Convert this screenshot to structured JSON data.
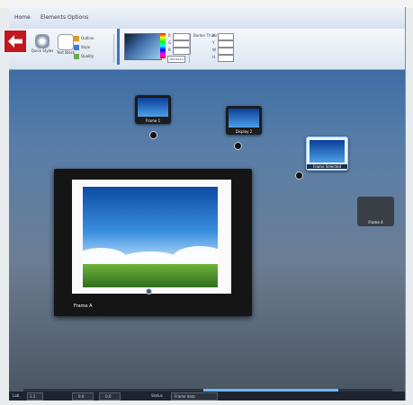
{
  "menu": {
    "tabs": [
      "Home",
      "Elements",
      "Options"
    ]
  },
  "ribbon": {
    "buttons": {
      "b1": "Quick Styles",
      "b2": "Text Block",
      "s1": "Outline",
      "s2": "Style",
      "s3": "Quality"
    },
    "color": {
      "r": "R",
      "g": "G",
      "b": "B",
      "a": "A",
      "hex": "#0C4AA3",
      "border_label": "Border Thickness",
      "bx": "X",
      "by": "Y",
      "bw": "W",
      "bh": "H"
    }
  },
  "back_button": {
    "label": "Back"
  },
  "frames": {
    "f1": "Frame 1",
    "f2": "Display 2",
    "f3": "Frame Selected",
    "f4": "Frame 4",
    "fA": "Frame A"
  },
  "connectors": {
    "c1": "1",
    "c2": "2",
    "c3": "3",
    "c4": "4"
  },
  "status": {
    "s1": "Lab",
    "s2": "1.5",
    "s3": "0.0",
    "s4": "0.0",
    "s5": "Status",
    "s6": "Frame data"
  },
  "colors": {
    "accent_red": "#c3171f",
    "canvas_blue": "#3e6ea5",
    "selection": "#9fd0ff",
    "status_bar": "#1d2430"
  }
}
